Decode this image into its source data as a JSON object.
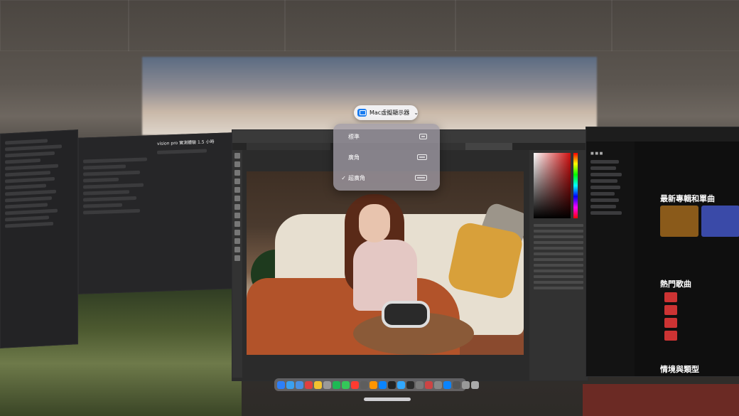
{
  "display_menu": {
    "button_label": "Mac虛擬顯示器",
    "options": [
      {
        "label": "標準",
        "checked": false,
        "icon": "display-standard-icon"
      },
      {
        "label": "廣角",
        "checked": false,
        "icon": "display-wide-icon"
      },
      {
        "label": "超廣角",
        "checked": true,
        "icon": "display-ultrawide-icon"
      }
    ],
    "check_mark": "✓"
  },
  "youtube": {
    "section_new_albums": "最新專輯和單曲",
    "section_hot_songs": "熱門歌曲",
    "section_mood": "情境與類型"
  },
  "notes": {
    "title": "vision pro 實測體驗 1.5 小時"
  },
  "colors": {
    "menu_bg": "#a09ba5",
    "pill_bg": "#f5f5f8",
    "accent": "#1a7cf0",
    "yt_red": "#cc3333"
  }
}
